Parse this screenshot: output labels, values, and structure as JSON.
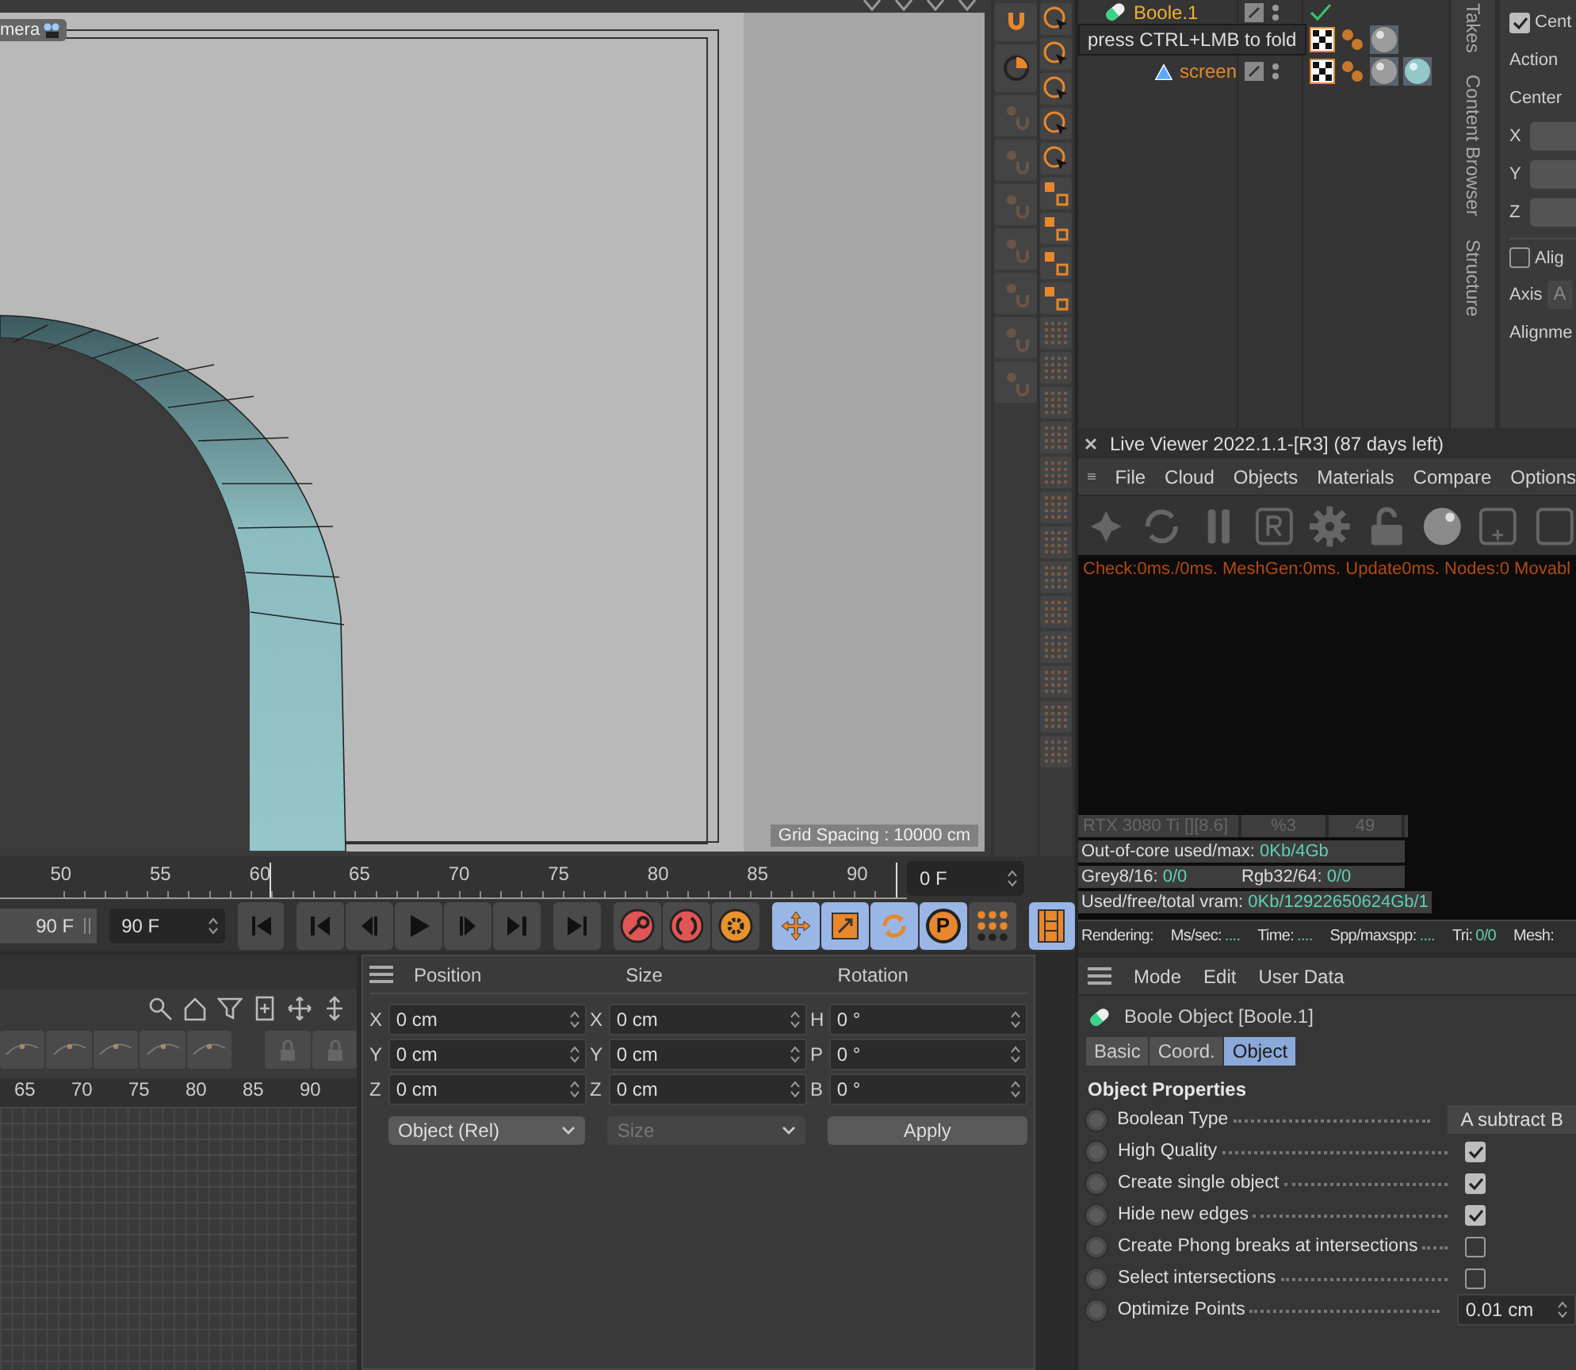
{
  "viewport": {
    "camera_label": "mera",
    "grid_spacing": "Grid Spacing : 10000 cm"
  },
  "object_manager": {
    "tooltip": "press CTRL+LMB to fold",
    "objects": [
      {
        "name": "Boole.1",
        "kind": "boole",
        "tags": [
          {
            "kind": "check"
          }
        ],
        "children": [
          {
            "tags": [
              {
                "kind": "texture"
              },
              {
                "kind": "points"
              },
              {
                "kind": "material",
                "color": "#9c9c9c"
              }
            ],
            "children": [
              {
                "name": "screen",
                "kind": "polygon",
                "tags": [
                  {
                    "kind": "texture"
                  },
                  {
                    "kind": "points"
                  },
                  {
                    "kind": "material",
                    "color": "#9c9c9c"
                  },
                  {
                    "kind": "material",
                    "color": "#93c8c8"
                  }
                ]
              }
            ]
          }
        ]
      }
    ]
  },
  "side_tabs": [
    "Takes",
    "Content Browser",
    "Structure"
  ],
  "side_attributes": {
    "center_check": {
      "label": "Cent",
      "checked": true
    },
    "action": "Action",
    "center": "Center",
    "axes": [
      "X",
      "Y",
      "Z"
    ],
    "align_check": {
      "label": "Alig",
      "checked": false
    },
    "axis": "Axis",
    "axis_value": "A",
    "alignment": "Alignme"
  },
  "live_viewer": {
    "title": "Live Viewer 2022.1.1-[R3] (87 days left)",
    "menu": [
      "File",
      "Cloud",
      "Objects",
      "Materials",
      "Compare",
      "Options"
    ],
    "log": "Check:0ms./0ms. MeshGen:0ms. Update0ms. Nodes:0 Movabl",
    "gpu": [
      "RTX 3080 Ti [][8.6]",
      "%3",
      "49"
    ],
    "stats": [
      [
        {
          "label": "Out-of-core used/max:",
          "value": "0Kb/4Gb"
        }
      ],
      [
        {
          "label": "Grey8/16:",
          "value": "0/0"
        },
        {
          "label": "Rgb32/64:",
          "value": "0/0"
        }
      ],
      [
        {
          "label": "Used/free/total vram:",
          "value": "0Kb/12922650624Gb/1"
        }
      ]
    ],
    "status": [
      {
        "label": "Rendering:"
      },
      {
        "label": "Ms/sec:",
        "value": "...."
      },
      {
        "label": "Time:",
        "value": "...."
      },
      {
        "label": "Spp/maxspp:",
        "value": "...."
      },
      {
        "label": "Tri:",
        "value": "0/0"
      },
      {
        "label": "Mesh:"
      }
    ]
  },
  "timeline": {
    "ruler": [
      "50",
      "55",
      "60",
      "65",
      "70",
      "75",
      "80",
      "85",
      "90"
    ],
    "current_frame": "0 F",
    "min_frame": "90 F",
    "max_frame": "90 F",
    "toggles": [
      {
        "kind": "move",
        "on": true
      },
      {
        "kind": "scale",
        "on": true
      },
      {
        "kind": "rotate",
        "on": true
      },
      {
        "kind": "param",
        "label": "P",
        "on": true
      },
      {
        "kind": "points",
        "on": false
      }
    ],
    "film_on": true
  },
  "fcurve_panel": {
    "ruler": [
      "65",
      "70",
      "75",
      "80",
      "85",
      "90"
    ]
  },
  "coordinates": {
    "headers": [
      "Position",
      "Size",
      "Rotation"
    ],
    "rows": [
      [
        {
          "axis": "X",
          "value": "0 cm"
        },
        {
          "axis": "X",
          "value": "0 cm"
        },
        {
          "axis": "H",
          "value": "0 °"
        }
      ],
      [
        {
          "axis": "Y",
          "value": "0 cm"
        },
        {
          "axis": "Y",
          "value": "0 cm"
        },
        {
          "axis": "P",
          "value": "0 °"
        }
      ],
      [
        {
          "axis": "Z",
          "value": "0 cm"
        },
        {
          "axis": "Z",
          "value": "0 cm"
        },
        {
          "axis": "B",
          "value": "0 °"
        }
      ]
    ],
    "mode": "Object (Rel)",
    "size_mode": {
      "label": "Size",
      "disabled": true
    },
    "apply": "Apply"
  },
  "attributes": {
    "menu": [
      "Mode",
      "Edit",
      "User Data"
    ],
    "title": "Boole Object [Boole.1]",
    "tabs": [
      {
        "label": "Basic",
        "selected": false
      },
      {
        "label": "Coord.",
        "selected": false
      },
      {
        "label": "Object",
        "selected": true
      }
    ],
    "section": "Object Properties",
    "properties": [
      {
        "kind": "dropdown",
        "label": "Boolean Type",
        "value": "A subtract B"
      },
      {
        "kind": "checkbox",
        "label": "High Quality",
        "checked": true
      },
      {
        "kind": "checkbox",
        "label": "Create single object",
        "checked": true
      },
      {
        "kind": "checkbox",
        "label": "Hide new edges",
        "checked": true
      },
      {
        "kind": "checkbox",
        "label": "Create Phong breaks at intersections",
        "checked": false
      },
      {
        "kind": "checkbox",
        "label": "Select intersections",
        "checked": false
      },
      {
        "kind": "number",
        "label": "Optimize Points",
        "value": "0.01 cm"
      }
    ]
  }
}
